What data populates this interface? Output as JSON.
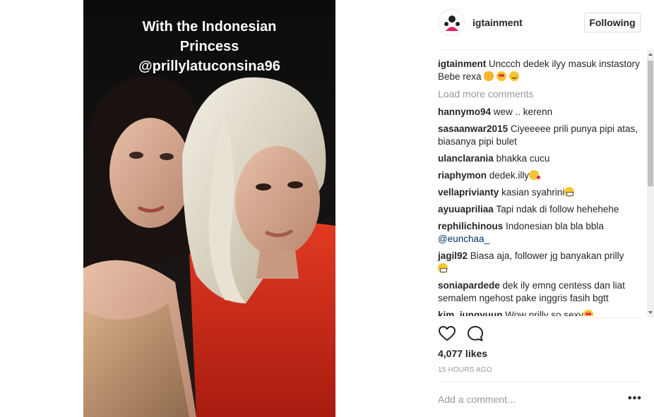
{
  "post": {
    "caption_lines": [
      "With the Indonesian",
      "Princess",
      "@prillylatuconsina96"
    ]
  },
  "header": {
    "username": "igtainment",
    "follow_label": "Following"
  },
  "caption": {
    "user": "igtainment",
    "text": "Unccch dedek ilyy masuk instastory Bebe rexa",
    "emojis": [
      "clapping-hands",
      "heart-eyes",
      "blush"
    ]
  },
  "load_more_label": "Load more comments",
  "comments": [
    {
      "user": "hannymo94",
      "text": "wew .. kerenn"
    },
    {
      "user": "sasaanwar2015",
      "text": "Ciyeeeee prili punya pipi atas, biasanya pipi bulet"
    },
    {
      "user": "ulanclarania",
      "text": "bhakka cucu"
    },
    {
      "user": "riaphymon",
      "text": "dedek.illy",
      "emoji": "wink"
    },
    {
      "user": "vellaprivianty",
      "text": "kasian syahrini",
      "emoji": "grimace"
    },
    {
      "user": "ayuuapriliaa",
      "text": "Tapi ndak di follow hehehehe"
    },
    {
      "user": "rephilichinous",
      "text": "Indonesian bla bla bbla",
      "mention": "@eunchaa_"
    },
    {
      "user": "jagil92",
      "text": "Biasa aja, follower jg banyakan prilly",
      "emoji": "grimace"
    },
    {
      "user": "soniapardede",
      "text": "dek ily emng centess dan liat semalem ngehost pake inggris fasih bgtt"
    },
    {
      "user": "kim_jungyuun",
      "text": "Wow prilly so sexy",
      "emoji": "heart-eyes"
    }
  ],
  "actions": {
    "like_icon": "heart-outline-icon",
    "comment_icon": "speech-bubble-icon"
  },
  "likes_text": "4,077 likes",
  "timestamp": "15 HOURS AGO",
  "add_comment": {
    "placeholder": "Add a comment..."
  },
  "more_options_label": "•••",
  "colors": {
    "text": "#262626",
    "muted": "#999999",
    "mention": "#003569",
    "border": "#dbdbdb"
  }
}
